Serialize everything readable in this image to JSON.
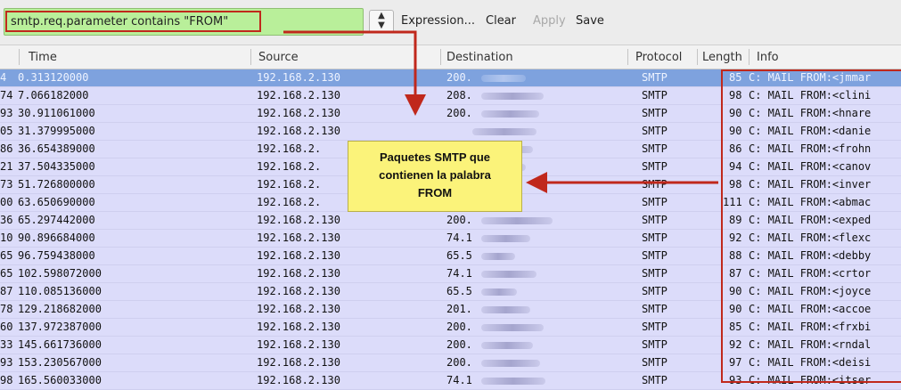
{
  "toolbar": {
    "filter_value": "smtp.req.parameter contains \"FROM\"",
    "history_icon": "chevron-up-down-icon",
    "expression_label": "Expression...",
    "clear_label": "Clear",
    "apply_label": "Apply",
    "save_label": "Save"
  },
  "columns": {
    "time": "Time",
    "source": "Source",
    "destination": "Destination",
    "protocol": "Protocol",
    "length": "Length",
    "info": "Info"
  },
  "rows": [
    {
      "no": "4",
      "time": "0.313120000",
      "source": "192.168.2.130",
      "dest": "200.",
      "protocol": "SMTP",
      "length": "85",
      "info": "C: MAIL FROM:<jmmar",
      "selected": true
    },
    {
      "no": "74",
      "time": "7.066182000",
      "source": "192.168.2.130",
      "dest": "208.",
      "protocol": "SMTP",
      "length": "98",
      "info": "C: MAIL FROM:<clini"
    },
    {
      "no": "93",
      "time": "30.911061000",
      "source": "192.168.2.130",
      "dest": "200.",
      "protocol": "SMTP",
      "length": "90",
      "info": "C: MAIL FROM:<hnare"
    },
    {
      "no": "05",
      "time": "31.379995000",
      "source": "192.168.2.130",
      "dest": "",
      "protocol": "SMTP",
      "length": "90",
      "info": "C: MAIL FROM:<danie"
    },
    {
      "no": "86",
      "time": "36.654389000",
      "source": "192.168.2.",
      "dest": "",
      "protocol": "SMTP",
      "length": "86",
      "info": "C: MAIL FROM:<frohn"
    },
    {
      "no": "21",
      "time": "37.504335000",
      "source": "192.168.2.",
      "dest": "",
      "protocol": "SMTP",
      "length": "94",
      "info": "C: MAIL FROM:<canov"
    },
    {
      "no": "73",
      "time": "51.726800000",
      "source": "192.168.2.",
      "dest": "",
      "protocol": "SMTP",
      "length": "98",
      "info": "C: MAIL FROM:<inver"
    },
    {
      "no": "00",
      "time": "63.650690000",
      "source": "192.168.2.",
      "dest": "",
      "protocol": "SMTP",
      "length": "111",
      "info": "C: MAIL FROM:<abmac"
    },
    {
      "no": "36",
      "time": "65.297442000",
      "source": "192.168.2.130",
      "dest": "200.",
      "protocol": "SMTP",
      "length": "89",
      "info": "C: MAIL FROM:<exped"
    },
    {
      "no": "10",
      "time": "90.896684000",
      "source": "192.168.2.130",
      "dest": "74.1",
      "protocol": "SMTP",
      "length": "92",
      "info": "C: MAIL FROM:<flexc"
    },
    {
      "no": "65",
      "time": "96.759438000",
      "source": "192.168.2.130",
      "dest": "65.5",
      "protocol": "SMTP",
      "length": "88",
      "info": "C: MAIL FROM:<debby"
    },
    {
      "no": "65",
      "time": "102.598072000",
      "source": "192.168.2.130",
      "dest": "74.1",
      "protocol": "SMTP",
      "length": "87",
      "info": "C: MAIL FROM:<crtor"
    },
    {
      "no": "87",
      "time": "110.085136000",
      "source": "192.168.2.130",
      "dest": "65.5",
      "protocol": "SMTP",
      "length": "90",
      "info": "C: MAIL FROM:<joyce"
    },
    {
      "no": "78",
      "time": "129.218682000",
      "source": "192.168.2.130",
      "dest": "201.",
      "protocol": "SMTP",
      "length": "90",
      "info": "C: MAIL FROM:<accoe"
    },
    {
      "no": "60",
      "time": "137.972387000",
      "source": "192.168.2.130",
      "dest": "200.",
      "protocol": "SMTP",
      "length": "85",
      "info": "C: MAIL FROM:<frxbi"
    },
    {
      "no": "33",
      "time": "145.661736000",
      "source": "192.168.2.130",
      "dest": "200.",
      "protocol": "SMTP",
      "length": "92",
      "info": "C: MAIL FROM:<rndal"
    },
    {
      "no": "93",
      "time": "153.230567000",
      "source": "192.168.2.130",
      "dest": "200.",
      "protocol": "SMTP",
      "length": "97",
      "info": "C: MAIL FROM:<deisi"
    },
    {
      "no": "98",
      "time": "165.560033000",
      "source": "192.168.2.130",
      "dest": "74.1",
      "protocol": "SMTP",
      "length": "93",
      "info": "C: MAIL FROM:<itser"
    }
  ],
  "callout": {
    "line1": "Paquetes SMTP que",
    "line2": "contienen la palabra",
    "line3": "FROM"
  },
  "colors": {
    "filter_valid_bg": "#b9ef9a",
    "row_bg": "#dcdcfa",
    "row_selected_bg": "#7ea2de",
    "annotation_red": "#c0281c",
    "callout_bg": "#fbf37a"
  }
}
